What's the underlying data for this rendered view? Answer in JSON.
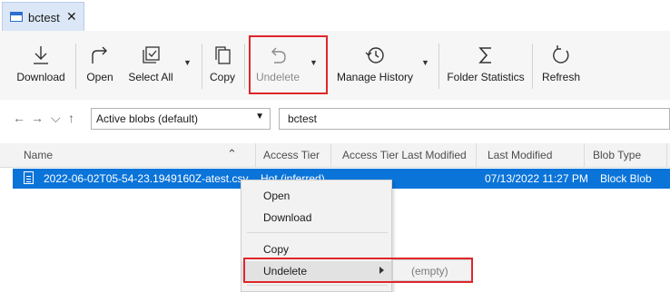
{
  "tab": {
    "title": "bctest",
    "close": "✕"
  },
  "toolbar": {
    "download": "Download",
    "open": "Open",
    "select_all": "Select All",
    "copy": "Copy",
    "undelete": "Undelete",
    "manage_history": "Manage History",
    "folder_statistics": "Folder Statistics",
    "refresh": "Refresh",
    "dropdown_glyph": "▼"
  },
  "nav": {
    "back": "←",
    "forward": "→",
    "recent": "⌵",
    "up": "↑",
    "view_mode": "Active blobs (default)",
    "path": "bctest"
  },
  "columns": {
    "name": "Name",
    "sort_glyph": "⌃",
    "access_tier": "Access Tier",
    "access_tier_last_modified": "Access Tier Last Modified",
    "last_modified": "Last Modified",
    "blob_type": "Blob Type"
  },
  "rows": [
    {
      "name": "2022-06-02T05-54-23.1949160Z-atest.csv",
      "access_tier": "Hot (inferred)",
      "last_modified": "07/13/2022 11:27 PM",
      "blob_type": "Block Blob"
    }
  ],
  "context_menu": {
    "items": [
      "Open",
      "Download",
      "Copy",
      "Undelete"
    ],
    "submenu_empty": "(empty)"
  },
  "colors": {
    "accent": "#0a74d9",
    "highlight_box": "#e0262b"
  }
}
